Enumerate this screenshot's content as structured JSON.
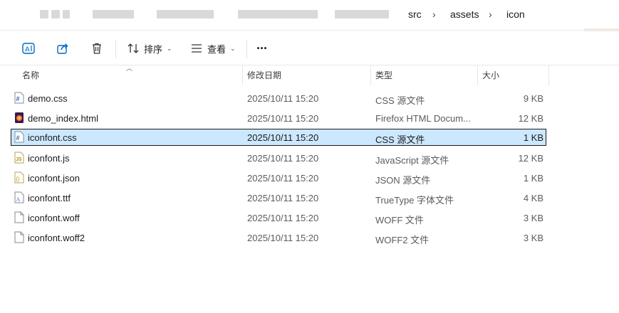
{
  "breadcrumb": {
    "items": [
      "src",
      "assets",
      "icon"
    ]
  },
  "toolbar": {
    "sort_label": "排序",
    "view_label": "查看",
    "more_label": "···"
  },
  "columns": {
    "name": "名称",
    "modified": "修改日期",
    "type": "类型",
    "size": "大小"
  },
  "files": [
    {
      "name": "demo.css",
      "modified": "2025/10/11 15:20",
      "type": "CSS 源文件",
      "size": "9 KB",
      "icon": "css-file-icon",
      "selected": false
    },
    {
      "name": "demo_index.html",
      "modified": "2025/10/11 15:20",
      "type": "Firefox HTML Docum...",
      "size": "12 KB",
      "icon": "firefox-html-file-icon",
      "selected": false
    },
    {
      "name": "iconfont.css",
      "modified": "2025/10/11 15:20",
      "type": "CSS 源文件",
      "size": "1 KB",
      "icon": "css-file-icon",
      "selected": true
    },
    {
      "name": "iconfont.js",
      "modified": "2025/10/11 15:20",
      "type": "JavaScript 源文件",
      "size": "12 KB",
      "icon": "js-file-icon",
      "selected": false
    },
    {
      "name": "iconfont.json",
      "modified": "2025/10/11 15:20",
      "type": "JSON 源文件",
      "size": "1 KB",
      "icon": "json-file-icon",
      "selected": false
    },
    {
      "name": "iconfont.ttf",
      "modified": "2025/10/11 15:20",
      "type": "TrueType 字体文件",
      "size": "4 KB",
      "icon": "font-file-icon",
      "selected": false
    },
    {
      "name": "iconfont.woff",
      "modified": "2025/10/11 15:20",
      "type": "WOFF 文件",
      "size": "3 KB",
      "icon": "blank-file-icon",
      "selected": false
    },
    {
      "name": "iconfont.woff2",
      "modified": "2025/10/11 15:20",
      "type": "WOFF2 文件",
      "size": "3 KB",
      "icon": "blank-file-icon",
      "selected": false
    }
  ],
  "colors": {
    "selection": "#cce8ff",
    "accent": "#0067c0"
  }
}
